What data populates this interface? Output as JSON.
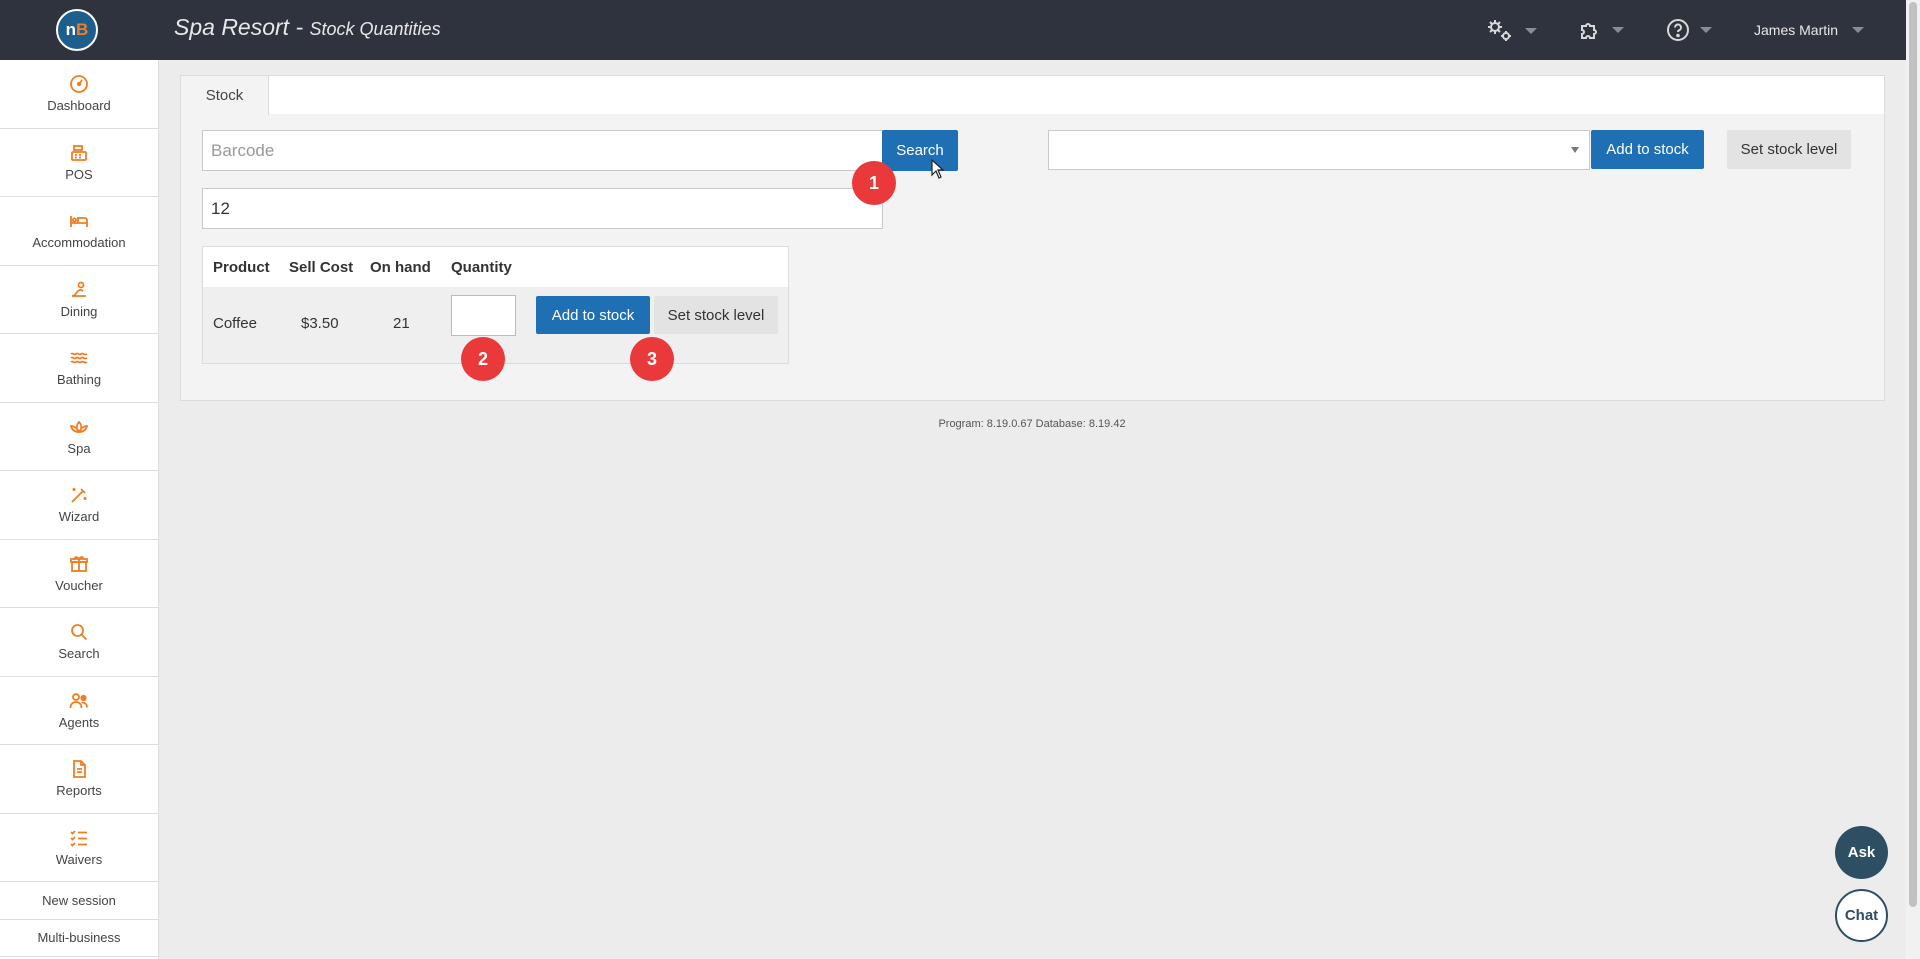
{
  "header": {
    "logo_text_n": "n",
    "logo_text_b": "B",
    "title": "Spa Resort - ",
    "subtitle": "Stock Quantities",
    "user_name": "James Martin",
    "icons": [
      "settings-gears-icon",
      "puzzle-icon",
      "help-icon"
    ]
  },
  "sidebar": {
    "items": [
      {
        "label": "Dashboard",
        "icon": "dashboard-icon"
      },
      {
        "label": "POS",
        "icon": "cash-register-icon"
      },
      {
        "label": "Accommodation",
        "icon": "bed-icon"
      },
      {
        "label": "Dining",
        "icon": "dining-icon"
      },
      {
        "label": "Bathing",
        "icon": "waves-icon"
      },
      {
        "label": "Spa",
        "icon": "lotus-icon"
      },
      {
        "label": "Wizard",
        "icon": "magic-wand-icon"
      },
      {
        "label": "Voucher",
        "icon": "gift-icon"
      },
      {
        "label": "Search",
        "icon": "search-icon"
      },
      {
        "label": "Agents",
        "icon": "agents-icon"
      },
      {
        "label": "Reports",
        "icon": "report-icon"
      },
      {
        "label": "Waivers",
        "icon": "checklist-icon"
      }
    ],
    "new_session": "New session",
    "multi_business": "Multi-business"
  },
  "tabs": [
    {
      "label": "Stock"
    }
  ],
  "stock": {
    "barcode_placeholder": "Barcode",
    "search_label": "Search",
    "search_value": "12",
    "dropdown_value": "",
    "add_to_stock_label": "Add to stock",
    "set_stock_level_label": "Set stock level"
  },
  "table": {
    "headers": [
      "Product",
      "Sell Cost",
      "On hand",
      "Quantity"
    ],
    "rows": [
      {
        "product": "Coffee",
        "sell_cost": "$3.50",
        "on_hand": "21",
        "quantity": ""
      }
    ],
    "add_to_stock_label": "Add to stock",
    "set_stock_level_label": "Set stock level"
  },
  "badges": [
    "1",
    "2",
    "3"
  ],
  "footer": {
    "version": "Program: 8.19.0.67 Database: 8.19.42"
  },
  "floating": {
    "ask": "Ask",
    "chat": "Chat"
  },
  "colors": {
    "accent": "#1f6fb5",
    "icon_orange": "#f07d22",
    "topbar": "#2f333d",
    "badge": "#e9393b"
  }
}
